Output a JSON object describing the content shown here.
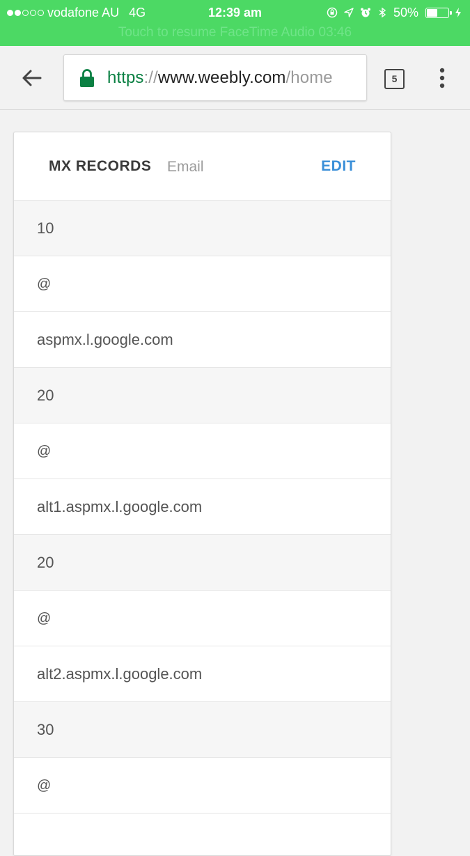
{
  "status_bar": {
    "carrier": "vodafone AU",
    "network": "4G",
    "time": "12:39 am",
    "battery": "50%",
    "battery_level": 0.5,
    "facetime_banner": "Touch to resume FaceTime Audio 03:46",
    "background_color": "#4cd964"
  },
  "browser": {
    "url_scheme": "https",
    "url_separator": "://",
    "url_host": "www.weebly.com",
    "url_path": "/home",
    "tab_count": "5"
  },
  "card": {
    "title": "MX RECORDS",
    "subtitle": "Email",
    "edit_label": "EDIT",
    "accent_color": "#3a8fd8",
    "rows": [
      {
        "text": "10",
        "kind": "priority"
      },
      {
        "text": "@",
        "kind": "host"
      },
      {
        "text": "aspmx.l.google.com",
        "kind": "value"
      },
      {
        "text": "20",
        "kind": "priority"
      },
      {
        "text": "@",
        "kind": "host"
      },
      {
        "text": "alt1.aspmx.l.google.com",
        "kind": "value"
      },
      {
        "text": "20",
        "kind": "priority"
      },
      {
        "text": "@",
        "kind": "host"
      },
      {
        "text": "alt2.aspmx.l.google.com",
        "kind": "value"
      },
      {
        "text": "30",
        "kind": "priority"
      },
      {
        "text": "@",
        "kind": "host"
      }
    ]
  }
}
